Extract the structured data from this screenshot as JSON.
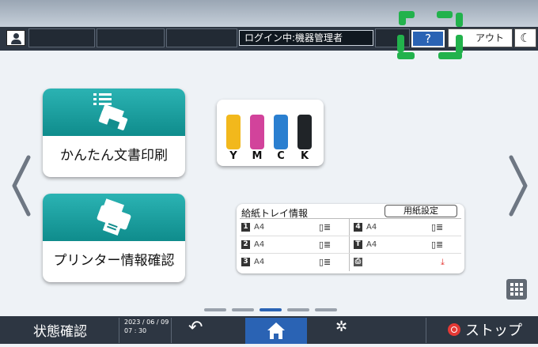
{
  "header": {
    "user_icon": "user-icon",
    "login_status": "ログイン中:機器管理者",
    "help_label": "?",
    "logout_label": "アウト",
    "energy_saver_icon": "moon-icon"
  },
  "tiles": {
    "easy_print_label": "かんたん文書印刷",
    "printer_info_label": "プリンター情報確認"
  },
  "ink": [
    {
      "letter": "Y",
      "color": "#f2b81c"
    },
    {
      "letter": "M",
      "color": "#d2439b"
    },
    {
      "letter": "C",
      "color": "#2a7fd0"
    },
    {
      "letter": "K",
      "color": "#202428"
    }
  ],
  "tray_panel": {
    "title": "給紙トレイ情報",
    "paper_settings_label": "用紙設定",
    "trays": [
      {
        "num": "1",
        "size": "A4"
      },
      {
        "num": "4",
        "size": "A4"
      },
      {
        "num": "2",
        "size": "A4"
      },
      {
        "num": "T",
        "size": "A4"
      },
      {
        "num": "3",
        "size": "A4"
      }
    ]
  },
  "page_indicator": {
    "count": 5,
    "active": 3
  },
  "bottom_bar": {
    "status_label": "状態確認",
    "date": "2023 / 06 / 09",
    "time": "07 : 30",
    "back_icon": "back-arrow-icon",
    "home_icon": "home-icon",
    "settings_icon": "gear-icon",
    "stop_label": "ストップ"
  },
  "colors": {
    "accent_blue": "#2a63b4",
    "teal": "#1a9ea0",
    "highlight_green": "#22b24c",
    "stop_red": "#e53935"
  }
}
